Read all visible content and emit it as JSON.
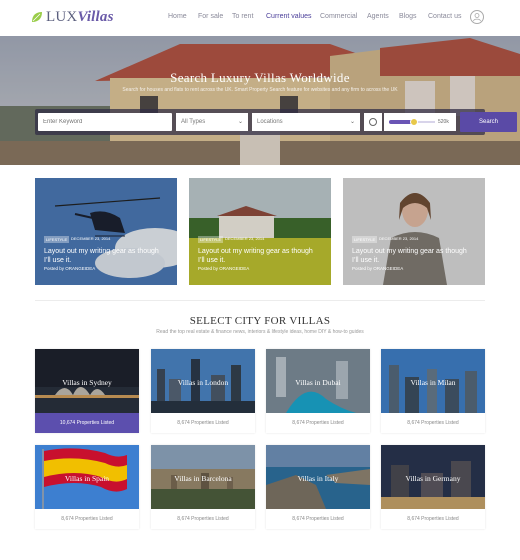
{
  "brand": {
    "prefix": "LUX",
    "suffix": "Villas",
    "accent": "#5a4aa6",
    "leaf_color": "#9acd4a"
  },
  "nav": {
    "items": [
      {
        "label": "Home",
        "active": false
      },
      {
        "label": "For sale",
        "active": false
      },
      {
        "label": "To rent",
        "active": false
      },
      {
        "label": "Current values",
        "active": true
      },
      {
        "label": "Commercial",
        "active": false
      },
      {
        "label": "Agents",
        "active": false
      },
      {
        "label": "Blogs",
        "active": false
      },
      {
        "label": "Contact us",
        "active": false
      }
    ],
    "user_icon": "user-circle-icon"
  },
  "hero": {
    "title": "Search Luxury Villas Worldwide",
    "subtitle": "Search for houses and flats to rent across the UK. Smart Property Search feature for websites and any firm to across the UK",
    "search": {
      "keyword_placeholder": "Enter Keyword",
      "type_value": "All Types",
      "location_value": "Locations",
      "range_label": "520k",
      "range_fraction": 0.55,
      "button_label": "Search"
    }
  },
  "blog_posts": [
    {
      "tag": "LIFESTYLE",
      "date": "DECEMBER 23, 2014",
      "title": "Layout out my writing gear as though I’ll use it.",
      "author": "Posted by ORANGEIDEA"
    },
    {
      "tag": "LIFESTYLE",
      "date": "DECEMBER 23, 2014",
      "title": "Layout out my writing gear as though I’ll use it.",
      "author": "Posted by ORANGEIDEA"
    },
    {
      "tag": "LIFESTYLE",
      "date": "DECEMBER 23, 2014",
      "title": "Layout out my writing gear as though I’ll use it.",
      "author": "Posted by ORANGEIDEA"
    }
  ],
  "cities_section": {
    "title": "SELECT CITY FOR VILLAS",
    "subtitle": "Read the top real estate & finance news, interiors & lifestyle ideas, home DIY & how-to guides",
    "cities": [
      {
        "name": "Villas in Sydney",
        "listed": "10,674 Properties Listed",
        "highlighted": true
      },
      {
        "name": "Villas in London",
        "listed": "8,674 Properties Listed",
        "highlighted": false
      },
      {
        "name": "Villas in Dubai",
        "listed": "8,674 Properties Listed",
        "highlighted": false
      },
      {
        "name": "Villas in Milan",
        "listed": "8,674 Properties Listed",
        "highlighted": false
      },
      {
        "name": "Villas in Spain",
        "listed": "8,674 Properties Listed",
        "highlighted": false
      },
      {
        "name": "Villas in Barcelona",
        "listed": "8,674 Properties Listed",
        "highlighted": false
      },
      {
        "name": "Villas in Italy",
        "listed": "8,674 Properties Listed",
        "highlighted": false
      },
      {
        "name": "Villas in Germany",
        "listed": "8,674 Properties Listed",
        "highlighted": false
      }
    ]
  }
}
